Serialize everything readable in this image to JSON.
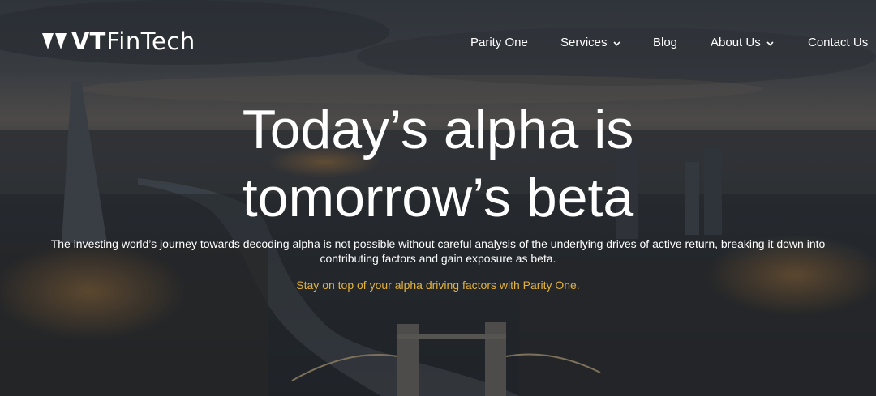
{
  "brand": {
    "name_bold": "VT",
    "name_light": "FinTech"
  },
  "nav": {
    "items": [
      {
        "label": "Parity One",
        "has_dropdown": false
      },
      {
        "label": "Services",
        "has_dropdown": true
      },
      {
        "label": "Blog",
        "has_dropdown": false
      },
      {
        "label": "About Us",
        "has_dropdown": true
      },
      {
        "label": "Contact Us",
        "has_dropdown": false
      }
    ]
  },
  "hero": {
    "headline_line1": "Today’s alpha is",
    "headline_line2": "tomorrow’s beta",
    "intro": "The investing world’s journey towards decoding alpha is not possible without careful analysis of the underlying drives of active return, breaking it down into contributing factors and gain exposure as beta.",
    "cta": "Stay on top of your alpha driving factors with Parity One."
  },
  "colors": {
    "text": "#ffffff",
    "accent": "#e2b33c",
    "overlay": "#1e2228"
  },
  "icons": {
    "logo": "vt-logo-chevrons-icon",
    "dropdown": "chevron-down-icon"
  }
}
